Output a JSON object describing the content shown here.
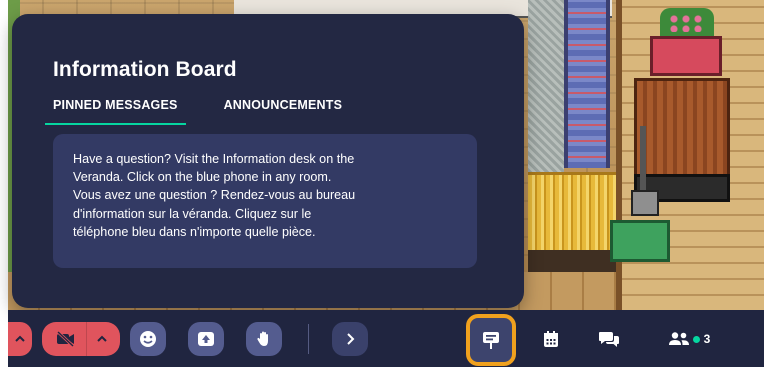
{
  "panel": {
    "title": "Information Board",
    "tabs": [
      {
        "label": "PINNED MESSAGES",
        "active": true
      },
      {
        "label": "ANNOUNCEMENTS",
        "active": false
      }
    ],
    "pinned_message": "Have a question? Visit the Information desk on the\nVeranda. Click on the blue phone in any room.\nVous avez une question ? Rendez-vous au bureau\nd'information sur la véranda. Cliquez sur le\ntéléphone bleu dans n'importe quelle pièce."
  },
  "toolbar": {
    "buttons": [
      {
        "name": "mic-options",
        "icon": "chevron-up-icon"
      },
      {
        "name": "camera",
        "icon": "video-off-icon"
      },
      {
        "name": "emoji",
        "icon": "smiley-icon"
      },
      {
        "name": "screen-share",
        "icon": "upload-icon"
      },
      {
        "name": "raise-hand",
        "icon": "hand-icon"
      },
      {
        "name": "more",
        "icon": "chevron-right-icon"
      },
      {
        "name": "information-board",
        "icon": "signboard-icon",
        "active": true
      },
      {
        "name": "calendar",
        "icon": "calendar-icon"
      },
      {
        "name": "chat",
        "icon": "chat-bubbles-icon"
      },
      {
        "name": "participants",
        "icon": "people-icon"
      }
    ],
    "participant_count": "3"
  },
  "colors": {
    "panel_bg": "#232843",
    "card_bg": "#333a64",
    "tab_underline": "#06d6a0",
    "toolbar_bg": "#202540",
    "muted_red": "#e0545d",
    "highlight_orange": "#f0a11e"
  }
}
